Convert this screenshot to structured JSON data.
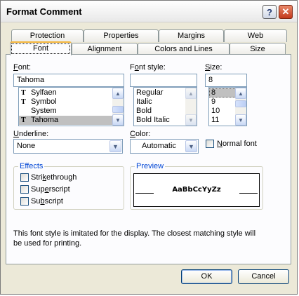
{
  "window": {
    "title": "Format Comment",
    "help_glyph": "?",
    "close_glyph": "✕"
  },
  "tabs": {
    "row_back": [
      "Protection",
      "Properties",
      "Margins",
      "Web"
    ],
    "row_front": [
      "Font",
      "Alignment",
      "Colors and Lines",
      "Size"
    ],
    "active": "Font"
  },
  "font": {
    "label_prefix": "",
    "label_u": "F",
    "label_rest": "ont:",
    "value": "Tahoma",
    "items": [
      {
        "icon": "truetype-icon",
        "glyph": "T",
        "label": "Sylfaen"
      },
      {
        "icon": "truetype-icon",
        "glyph": "T",
        "label": "Symbol"
      },
      {
        "icon": "",
        "glyph": "",
        "label": "System"
      },
      {
        "icon": "truetype-icon",
        "glyph": "T",
        "label": "Tahoma",
        "selected": true
      }
    ]
  },
  "font_style": {
    "label_prefix": "F",
    "label_u": "o",
    "label_rest": "nt style:",
    "value": "",
    "items": [
      "Regular",
      "Italic",
      "Bold",
      "Bold Italic"
    ]
  },
  "size": {
    "label_u": "S",
    "label_rest": "ize:",
    "value": "8",
    "items": [
      "8",
      "9",
      "10",
      "11"
    ],
    "selected": "8"
  },
  "underline": {
    "label_u": "U",
    "label_rest": "nderline:",
    "value": "None"
  },
  "color": {
    "label_u": "C",
    "label_rest": "olor:",
    "value": "Automatic"
  },
  "normal_font": {
    "label_u": "N",
    "label_rest": "ormal font",
    "checked": false
  },
  "effects": {
    "title": "Effects",
    "strikethrough": {
      "pre": "Stri",
      "u": "k",
      "post": "ethrough",
      "checked": false
    },
    "superscript": {
      "pre": "Sup",
      "u": "e",
      "post": "rscript",
      "checked": false
    },
    "subscript": {
      "pre": "Su",
      "u": "b",
      "post": "script",
      "checked": false
    }
  },
  "preview": {
    "title": "Preview",
    "sample": "AaBbCcYyZz"
  },
  "info_text_1": "This font style is imitated for the display.  The closest matching style will",
  "info_text_2": "be used for printing.",
  "buttons": {
    "ok": "OK",
    "cancel": "Cancel"
  }
}
